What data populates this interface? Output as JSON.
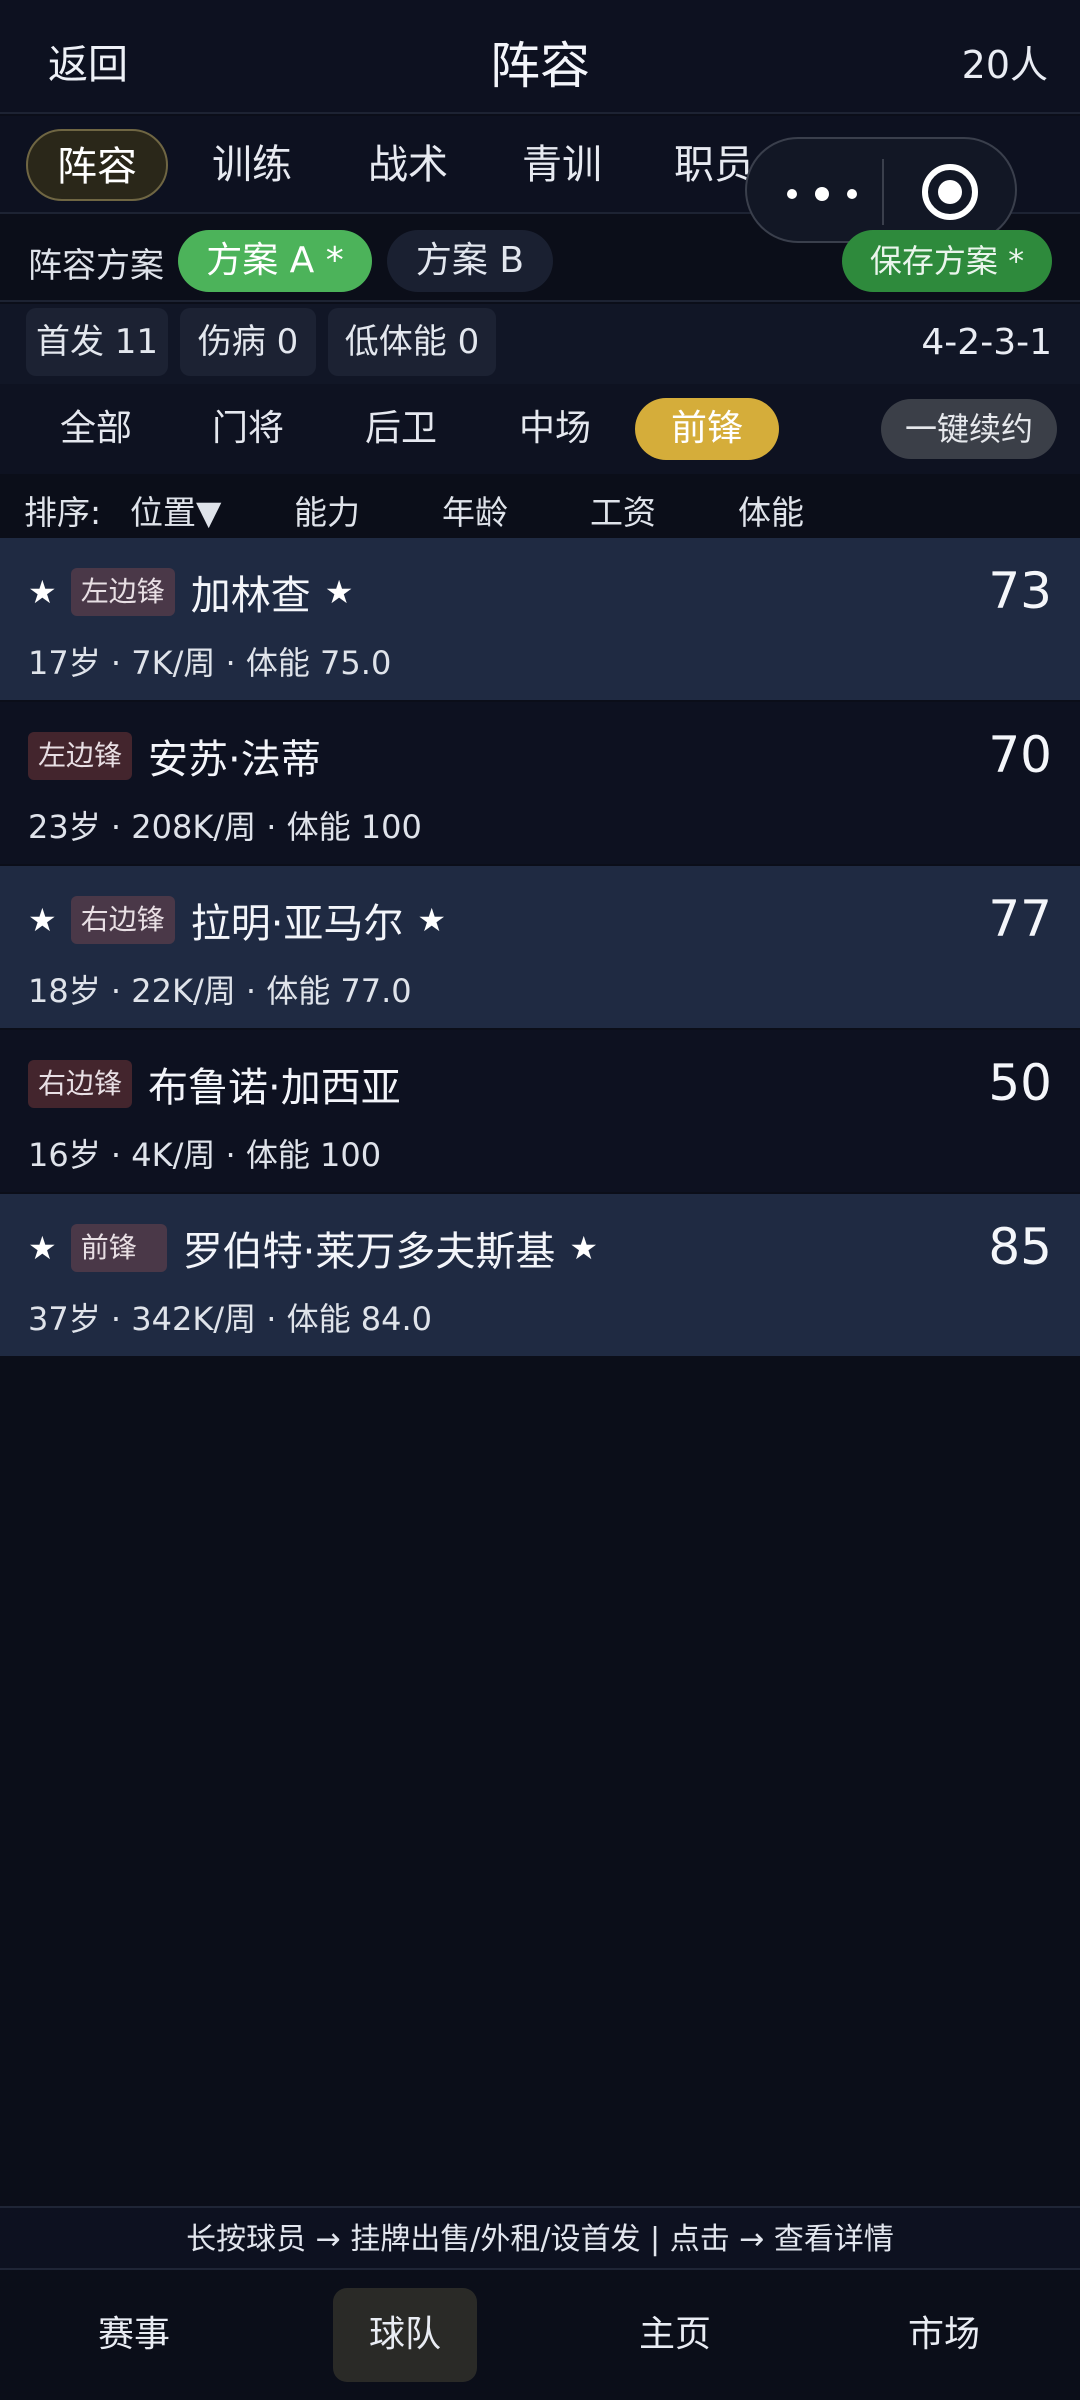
{
  "header": {
    "back_label": "返回",
    "title": "阵容",
    "count": "20人"
  },
  "main_tabs": [
    {
      "label": "阵容",
      "active": true
    },
    {
      "label": "训练",
      "active": false
    },
    {
      "label": "战术",
      "active": false
    },
    {
      "label": "青训",
      "active": false
    },
    {
      "label": "职员",
      "active": false
    }
  ],
  "scheme": {
    "label": "阵容方案",
    "options": [
      {
        "label": "方案 A *",
        "active": true
      },
      {
        "label": "方案 B",
        "active": false
      }
    ],
    "save_label": "保存方案 *"
  },
  "stats": {
    "starters": "首发 11",
    "injured": "伤病 0",
    "low_stamina": "低体能 0",
    "formation": "4-2-3-1"
  },
  "position_filter": {
    "tabs": [
      {
        "label": "全部",
        "active": false
      },
      {
        "label": "门将",
        "active": false
      },
      {
        "label": "后卫",
        "active": false
      },
      {
        "label": "中场",
        "active": false
      },
      {
        "label": "前锋",
        "active": true
      }
    ],
    "renew_all_label": "一键续约"
  },
  "sort": {
    "label": "排序:",
    "options": [
      "位置▼",
      "能力",
      "年龄",
      "工资",
      "体能"
    ]
  },
  "players": [
    {
      "starter": true,
      "position": "左边锋",
      "name": "加林查",
      "rating": "73",
      "info": "17岁 · 7K/周 · 体能 75.0"
    },
    {
      "starter": false,
      "position": "左边锋",
      "name": "安苏·法蒂",
      "rating": "70",
      "info": "23岁 · 208K/周 · 体能 100"
    },
    {
      "starter": true,
      "position": "右边锋",
      "name": "拉明·亚马尔",
      "rating": "77",
      "info": "18岁 · 22K/周 · 体能 77.0"
    },
    {
      "starter": false,
      "position": "右边锋",
      "name": "布鲁诺·加西亚",
      "rating": "50",
      "info": "16岁 · 4K/周 · 体能 100"
    },
    {
      "starter": true,
      "position": "前锋",
      "name": "罗伯特·莱万多夫斯基",
      "rating": "85",
      "info": "37岁 · 342K/周 · 体能 84.0"
    }
  ],
  "hint": "长按球员 → 挂牌出售/外租/设首发 | 点击 → 查看详情",
  "bottom_nav": [
    {
      "label": "赛事",
      "active": false
    },
    {
      "label": "球队",
      "active": true
    },
    {
      "label": "主页",
      "active": false
    },
    {
      "label": "市场",
      "active": false
    }
  ],
  "colors": {
    "background": "#0b0e19",
    "starter_row": "#1f2a42",
    "scheme_active": "#4cb35a",
    "save_button": "#2e8a3c",
    "position_active": "#d5ad3a"
  },
  "icons": {
    "star": "star-icon",
    "more": "more-dots-icon",
    "close": "target-circle-icon"
  }
}
